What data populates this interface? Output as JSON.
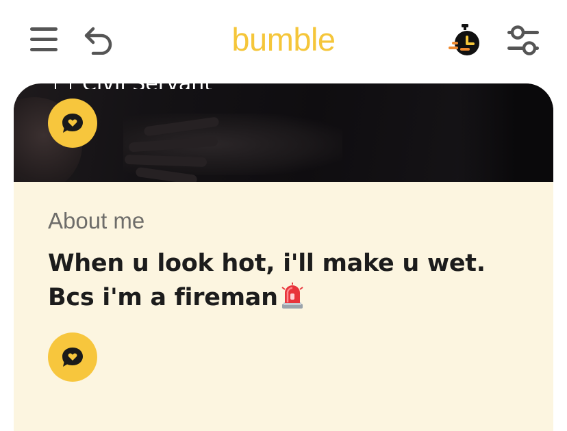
{
  "header": {
    "logo_text": "bumble",
    "menu_icon": "hamburger-menu-icon",
    "undo_icon": "undo-arrow-icon",
    "timer_icon": "speed-timer-icon",
    "filter_icon": "filter-sliders-icon",
    "accent_color": "#f5c63a"
  },
  "profile": {
    "job_title": "Civil Servant",
    "about": {
      "label": "About me",
      "text": "When u look hot, i'll make u wet. Bcs i'm a fireman",
      "emoji": "police-car-light"
    },
    "compliment_icon": "compliment-heart-bubble-icon"
  }
}
